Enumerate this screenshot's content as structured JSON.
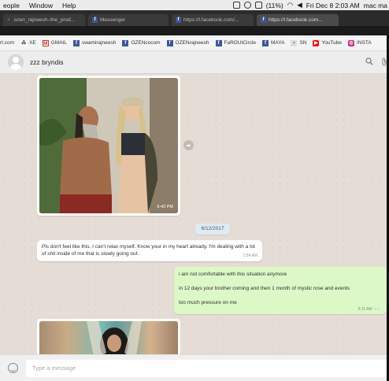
{
  "menubar": {
    "items": [
      "eople",
      "Window",
      "Help"
    ],
    "battery": "(11%)",
    "clock": "Fri Dec 8  2:03 AM",
    "user": "mac ma"
  },
  "tabs": [
    {
      "label": "ozen_rajneesh–the_prod..."
    },
    {
      "label": "Messenger"
    },
    {
      "label": "https://l.facebook.com/..."
    },
    {
      "label": "https://l.facebook.com..."
    }
  ],
  "bookmarks": [
    {
      "label": "rt.com",
      "icon": ""
    },
    {
      "label": "XE",
      "icon": "xe-icon"
    },
    {
      "label": "GMAIL",
      "icon": "gmail-icon"
    },
    {
      "label": "swamirajneesh",
      "icon": "facebook-icon"
    },
    {
      "label": "OZENcocom",
      "icon": "facebook-icon"
    },
    {
      "label": "OZENrajneesh",
      "icon": "facebook-icon"
    },
    {
      "label": "FaROUtCircle",
      "icon": "facebook-icon"
    },
    {
      "label": "MAYA",
      "icon": "facebook-icon"
    },
    {
      "label": "SN",
      "icon": "sn-icon"
    },
    {
      "label": "YouTube",
      "icon": "youtube-icon"
    },
    {
      "label": "INSTA",
      "icon": "instagram-icon"
    }
  ],
  "chat": {
    "contact_name": "zzz bryndis",
    "photo_time": "6:42 PM",
    "date_divider": "6/12/2017",
    "incoming": {
      "text": "Pls don't feel like this, I can't relax myself. Know your in my heart already. I'm dealing with a lot of shit inside of me that is slowly going out.",
      "time": "1:54 AM"
    },
    "outgoing": {
      "lines": [
        "i am not comfortable with this situation anymore",
        "in 12 days your brother coming and then 1 month of mystic rose and events",
        "too much pressure on me"
      ],
      "time": "9:11 AM",
      "ticks": "✓✓"
    }
  },
  "footer": {
    "placeholder": "Type a message"
  },
  "colors": {
    "chat_bg": "#e5ddd5",
    "outgoing_bubble": "#dcf8c6",
    "incoming_bubble": "#ffffff",
    "header_bg": "#ededed"
  }
}
